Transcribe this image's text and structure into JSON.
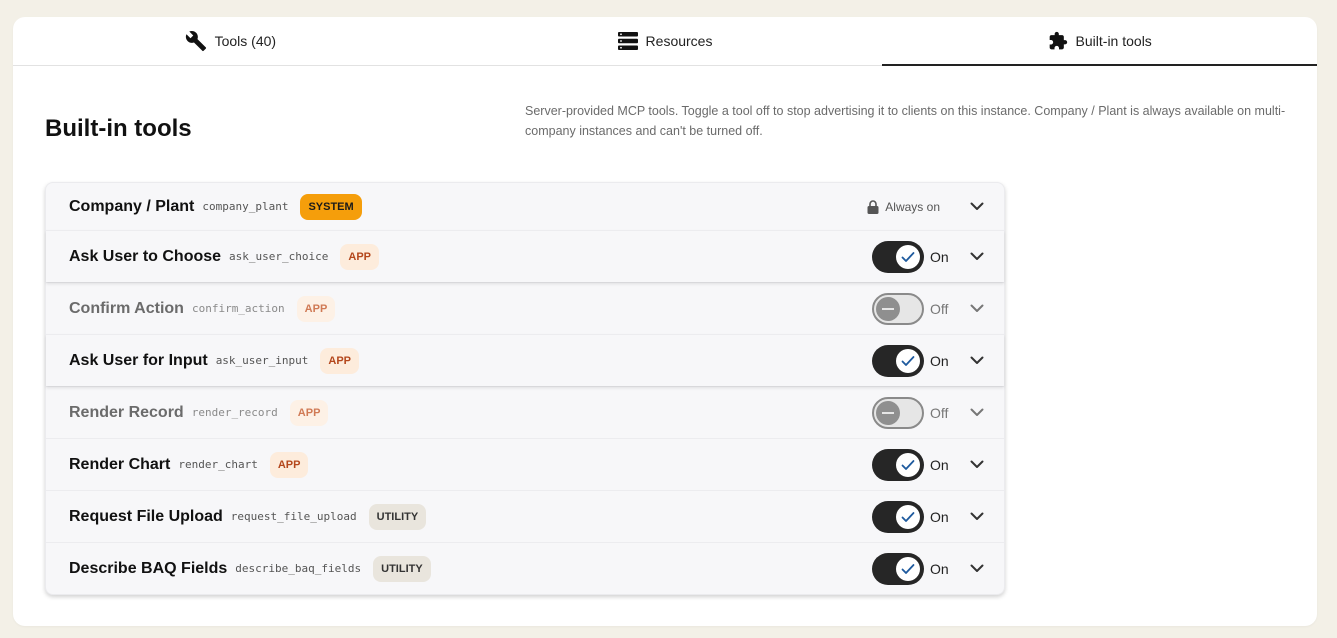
{
  "tabs": [
    {
      "label": "Tools (40)",
      "icon": "wrench-icon"
    },
    {
      "label": "Resources",
      "icon": "server-icon"
    },
    {
      "label": "Built-in tools",
      "icon": "puzzle-icon"
    }
  ],
  "page": {
    "title": "Built-in tools",
    "description": "Server-provided MCP tools. Toggle a tool off to stop advertising it to clients on this instance. Company / Plant is always available on multi-company instances and can't be turned off."
  },
  "tools": [
    {
      "name": "Company / Plant",
      "code": "company_plant",
      "badge": "SYSTEM",
      "state": "Always on"
    },
    {
      "name": "Ask User to Choose",
      "code": "ask_user_choice",
      "badge": "APP",
      "state": "On"
    },
    {
      "name": "Confirm Action",
      "code": "confirm_action",
      "badge": "APP",
      "state": "Off"
    },
    {
      "name": "Ask User for Input",
      "code": "ask_user_input",
      "badge": "APP",
      "state": "On"
    },
    {
      "name": "Render Record",
      "code": "render_record",
      "badge": "APP",
      "state": "Off"
    },
    {
      "name": "Render Chart",
      "code": "render_chart",
      "badge": "APP",
      "state": "On"
    },
    {
      "name": "Request File Upload",
      "code": "request_file_upload",
      "badge": "UTILITY",
      "state": "On"
    },
    {
      "name": "Describe BAQ Fields",
      "code": "describe_baq_fields",
      "badge": "UTILITY",
      "state": "On"
    }
  ],
  "colors": {
    "system_badge": "#f59e0b",
    "app_badge_bg": "#fdecdc",
    "utility_badge_bg": "#e9e5dd",
    "toggle_on": "#262626"
  }
}
